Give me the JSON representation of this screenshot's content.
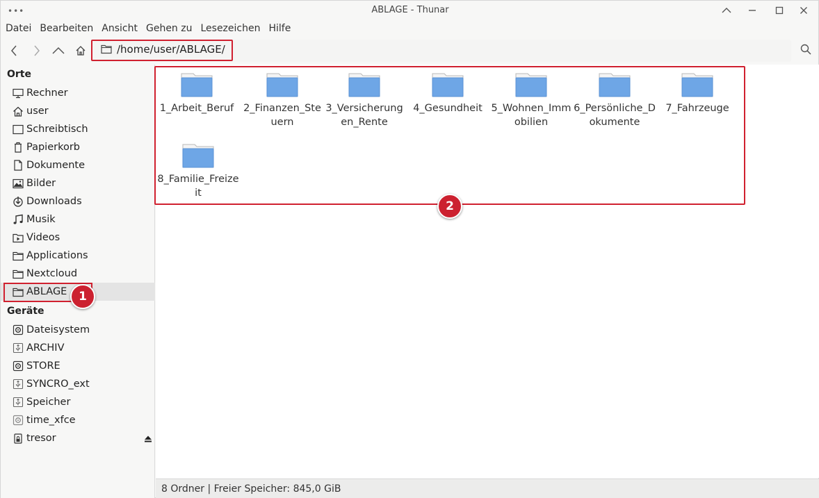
{
  "window": {
    "title": "ABLAGE - Thunar",
    "menu_icon": "dots-icon",
    "minimize_icon": "chevron-up-icon",
    "restore_icon": "minimize-icon",
    "maximize_icon": "maximize-icon",
    "close_icon": "close-icon"
  },
  "menubar": {
    "items": [
      "Datei",
      "Bearbeiten",
      "Ansicht",
      "Gehen zu",
      "Lesezeichen",
      "Hilfe"
    ]
  },
  "toolbar": {
    "back_icon": "chevron-left-icon",
    "forward_icon": "chevron-right-icon",
    "up_icon": "chevron-up-icon",
    "home_icon": "home-icon",
    "path": "/home/user/ABLAGE/",
    "search_icon": "search-icon"
  },
  "sidebar": {
    "places_header": "Orte",
    "places": [
      {
        "label": "Rechner",
        "icon": "monitor-icon"
      },
      {
        "label": "user",
        "icon": "home-icon"
      },
      {
        "label": "Schreibtisch",
        "icon": "desktop-icon"
      },
      {
        "label": "Papierkorb",
        "icon": "trash-icon"
      },
      {
        "label": "Dokumente",
        "icon": "document-icon"
      },
      {
        "label": "Bilder",
        "icon": "image-icon"
      },
      {
        "label": "Downloads",
        "icon": "download-icon"
      },
      {
        "label": "Musik",
        "icon": "music-icon"
      },
      {
        "label": "Videos",
        "icon": "video-icon"
      },
      {
        "label": "Applications",
        "icon": "folder-icon"
      },
      {
        "label": "Nextcloud",
        "icon": "folder-icon"
      },
      {
        "label": "ABLAGE",
        "icon": "folder-icon",
        "active": true
      }
    ],
    "devices_header": "Geräte",
    "devices": [
      {
        "label": "Dateisystem",
        "icon": "drive-icon"
      },
      {
        "label": "ARCHIV",
        "icon": "usb-drive-icon"
      },
      {
        "label": "STORE",
        "icon": "drive-icon"
      },
      {
        "label": "SYNCRO_ext",
        "icon": "usb-drive-icon"
      },
      {
        "label": "Speicher",
        "icon": "usb-drive-icon"
      },
      {
        "label": "time_xfce",
        "icon": "drive-icon"
      },
      {
        "label": "tresor",
        "icon": "lock-drive-icon"
      }
    ],
    "eject_icon": "eject-icon"
  },
  "annotations": {
    "badge_1": "1",
    "badge_2": "2",
    "highlight_color": "#d0202f"
  },
  "folders": [
    {
      "name": "1_Arbeit_Beruf"
    },
    {
      "name": "2_Finanzen_Steuern"
    },
    {
      "name": "3_Versicherungen_Rente"
    },
    {
      "name": "4_Gesundheit"
    },
    {
      "name": "5_Wohnen_Immobilien"
    },
    {
      "name": "6_Persönliche_Dokumente"
    },
    {
      "name": "7_Fahrzeuge"
    },
    {
      "name": "8_Familie_Freizeit"
    }
  ],
  "status": {
    "text": "8 Ordner  |  Freier Speicher: 845,0 GiB"
  },
  "colors": {
    "folder_blue": "#6ea6e6",
    "accent_red": "#cc2130"
  }
}
